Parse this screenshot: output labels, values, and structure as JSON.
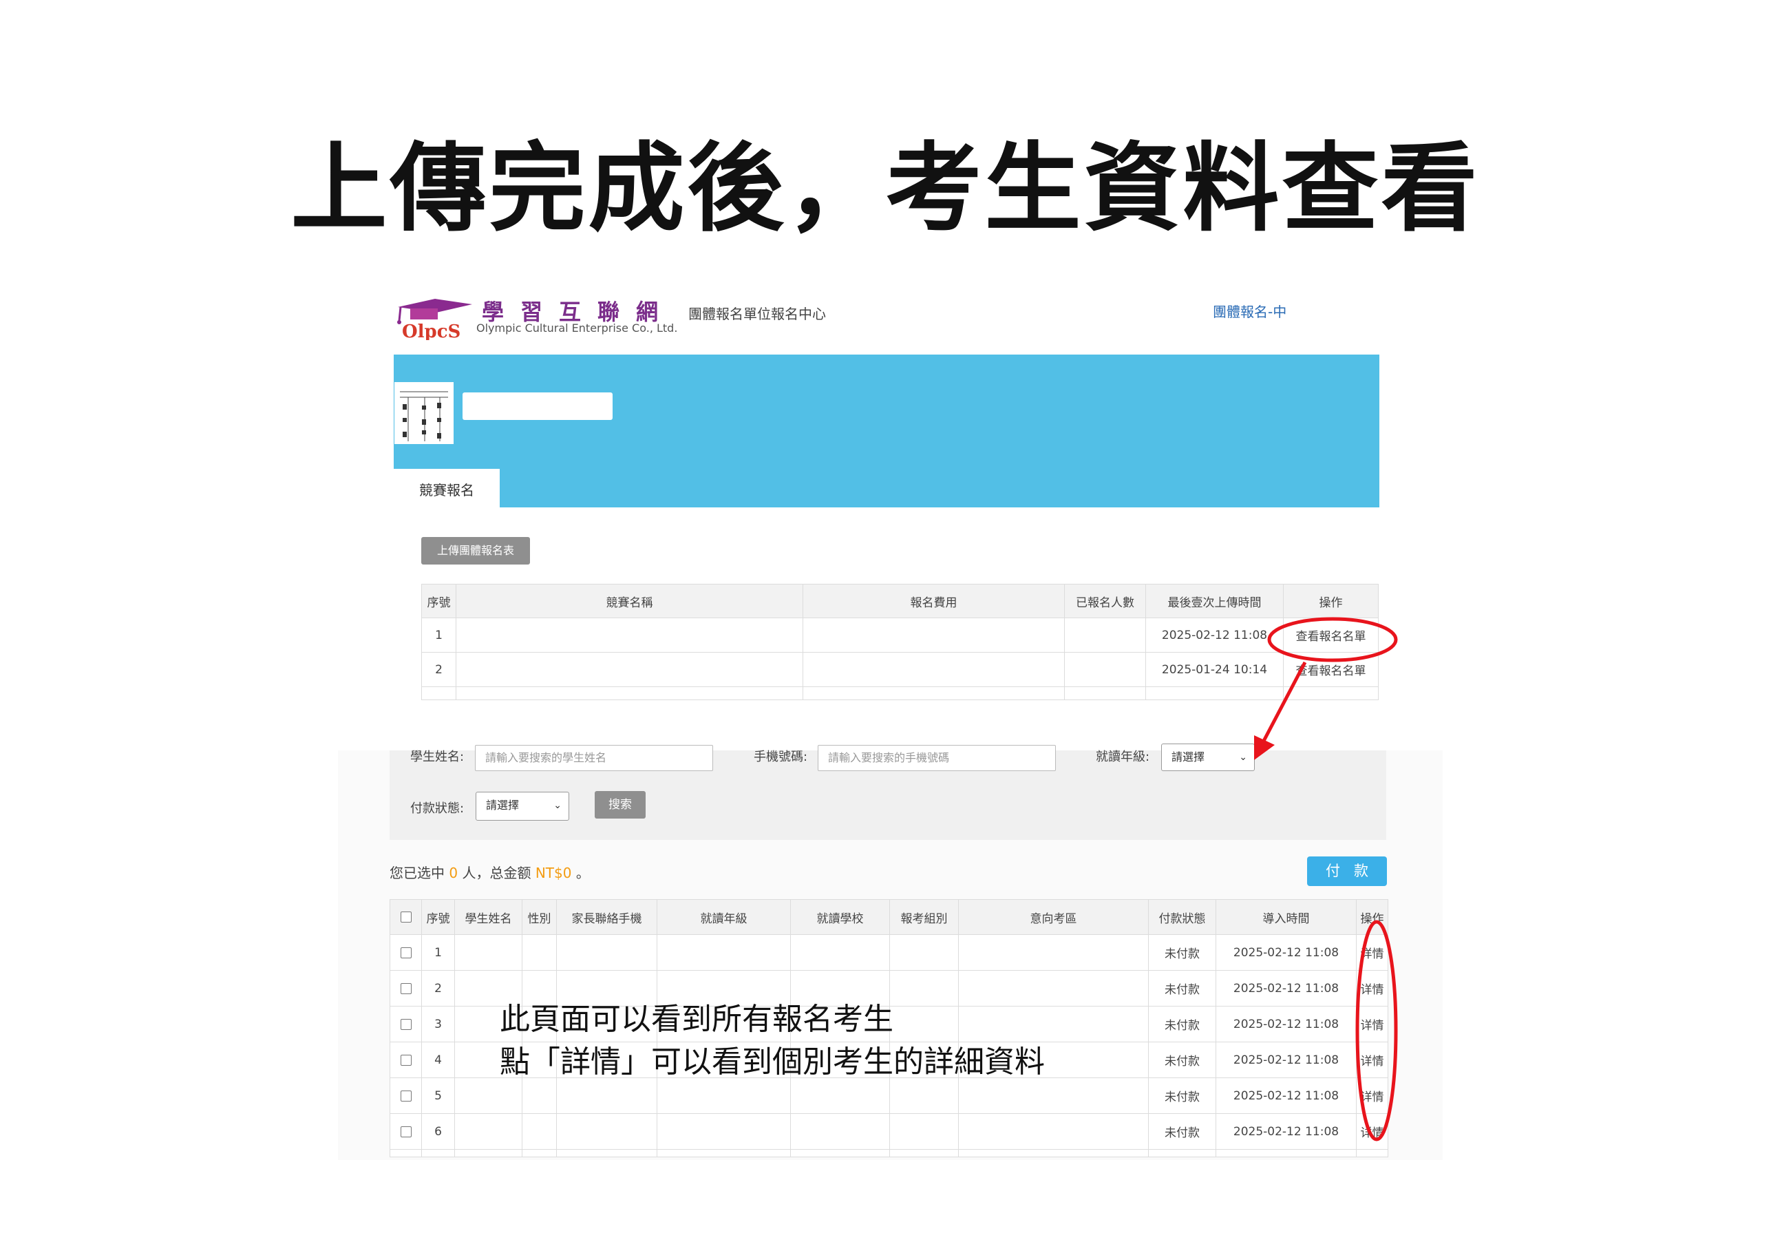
{
  "slide": {
    "title": "上傳完成後，考生資料查看"
  },
  "header": {
    "brand_cn": "學習互聯網",
    "brand_en": "Olympic Cultural Enterprise Co., Ltd.",
    "logo_text": "OlpcS",
    "subtitle": "團體報名單位報名中心",
    "right_link": "團體報名-中"
  },
  "tabs": [
    {
      "label": "競賽報名"
    }
  ],
  "toolbar": {
    "upload_label": "上傳團體報名表"
  },
  "competition_table": {
    "columns": [
      "序號",
      "競賽名稱",
      "報名費用",
      "已報名人數",
      "最後壹次上傳時間",
      "操作"
    ],
    "rows": [
      {
        "index": "1",
        "name": "",
        "fee": "",
        "count": "",
        "last_upload": "2025-02-12 11:08",
        "action": "查看報名名單"
      },
      {
        "index": "2",
        "name": "",
        "fee": "",
        "count": "",
        "last_upload": "2025-01-24 10:14",
        "action": "查看報名名單"
      }
    ]
  },
  "filters": {
    "student_name_label": "學生姓名:",
    "student_name_placeholder": "請輸入要搜索的學生姓名",
    "phone_label": "手機號碼:",
    "phone_placeholder": "請輸入要搜索的手機號碼",
    "grade_label": "就讀年級:",
    "grade_value": "請選擇",
    "payment_label": "付款狀態:",
    "payment_value": "請選擇",
    "search_label": "搜索"
  },
  "summary": {
    "prefix": "您已选中",
    "count": "0",
    "middle": "人，总金额",
    "amount": "NT$0",
    "suffix": "。"
  },
  "pay_button": "付款",
  "student_table": {
    "columns": [
      "序號",
      "學生姓名",
      "性別",
      "家長聯絡手機",
      "就讀年級",
      "就讀學校",
      "報考組別",
      "意向考區",
      "付款狀態",
      "導入時間",
      "操作"
    ],
    "rows": [
      {
        "index": "1",
        "status": "未付款",
        "time": "2025-02-12 11:08",
        "action": "详情"
      },
      {
        "index": "2",
        "status": "未付款",
        "time": "2025-02-12 11:08",
        "action": "详情"
      },
      {
        "index": "3",
        "status": "未付款",
        "time": "2025-02-12 11:08",
        "action": "详情"
      },
      {
        "index": "4",
        "status": "未付款",
        "time": "2025-02-12 11:08",
        "action": "详情"
      },
      {
        "index": "5",
        "status": "未付款",
        "time": "2025-02-12 11:08",
        "action": "详情"
      },
      {
        "index": "6",
        "status": "未付款",
        "time": "2025-02-12 11:08",
        "action": "详情"
      }
    ]
  },
  "note": {
    "line1": "此頁面可以看到所有報名考生",
    "line2": "點「詳情」可以看到個別考生的詳細資料"
  },
  "colors": {
    "banner": "#52bfe6",
    "pay_button": "#3bb0e8",
    "highlight": "#f39c12",
    "annotation_red": "#e8141c",
    "brand_purple": "#7b2d8b"
  }
}
